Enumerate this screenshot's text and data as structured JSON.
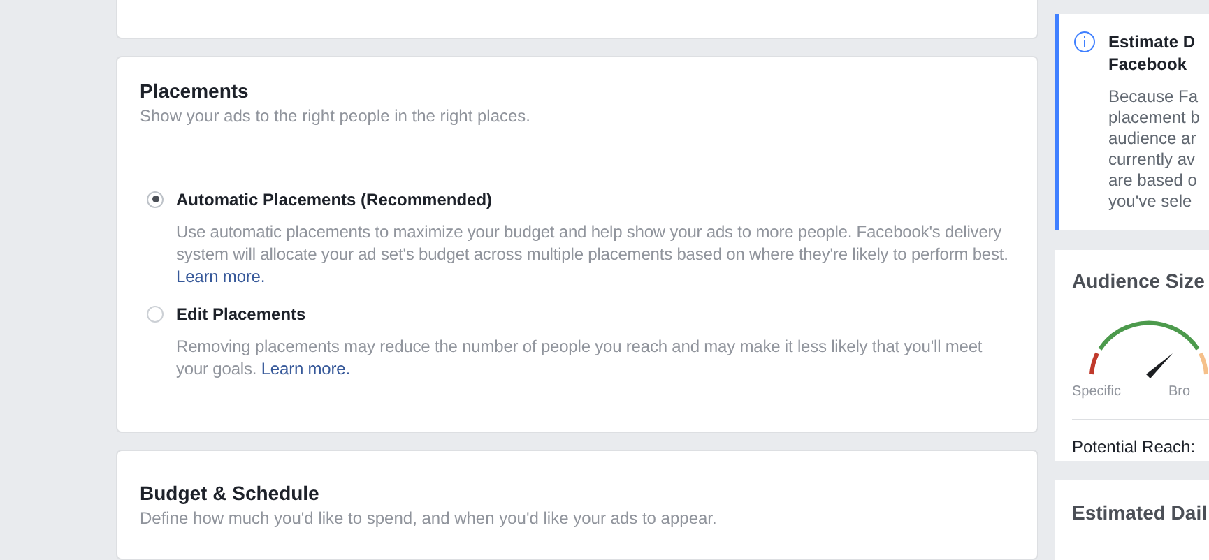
{
  "placements": {
    "title": "Placements",
    "subtitle": "Show your ads to the right people in the right places.",
    "options": [
      {
        "label": "Automatic Placements (Recommended)",
        "selected": true,
        "description": "Use automatic placements to maximize your budget and help show your ads to more people. Facebook's delivery system will allocate your ad set's budget across multiple placements based on where they're likely to perform best.",
        "link": "Learn more."
      },
      {
        "label": "Edit Placements",
        "selected": false,
        "description": "Removing placements may reduce the number of people you reach and may make it less likely that you'll meet your goals.",
        "link": "Learn more."
      }
    ]
  },
  "budget": {
    "title": "Budget & Schedule",
    "subtitle": "Define how much you'd like to spend, and when you'd like your ads to appear."
  },
  "info_card": {
    "title_lines": [
      "Estimate D",
      "Facebook"
    ],
    "body_lines": [
      "Because Fa",
      "placement b",
      "audience ar",
      "currently av",
      "are based o",
      "you've sele"
    ]
  },
  "audience": {
    "title": "Audience Size",
    "left_label": "Specific",
    "right_label": "Bro",
    "reach_label": "Potential Reach:"
  },
  "estimated": {
    "title": "Estimated Dail"
  }
}
